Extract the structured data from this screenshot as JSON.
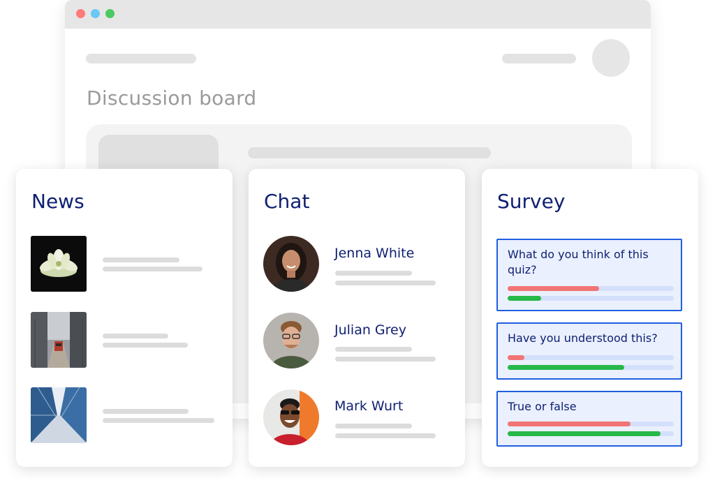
{
  "board": {
    "title": "Discussion board"
  },
  "news": {
    "title": "News",
    "items": [
      {
        "image": "succulent-plant-photo"
      },
      {
        "image": "city-street-tram-photo"
      },
      {
        "image": "skyscrapers-looking-up-photo"
      }
    ]
  },
  "chat": {
    "title": "Chat",
    "contacts": [
      {
        "name": "Jenna White"
      },
      {
        "name": "Julian Grey"
      },
      {
        "name": "Mark Wurt"
      }
    ]
  },
  "survey": {
    "title": "Survey",
    "questions": [
      {
        "text": "What do you think of this quiz?",
        "red": 0.55,
        "green": 0.2
      },
      {
        "text": "Have you understood this?",
        "red": 0.1,
        "green": 0.7
      },
      {
        "text": "True or false",
        "red": 0.74,
        "green": 0.92
      }
    ]
  },
  "colors": {
    "heading": "#0e1f72",
    "accent_border": "#1f5fe0",
    "bar_red": "#f27474",
    "bar_green": "#27b84a"
  }
}
